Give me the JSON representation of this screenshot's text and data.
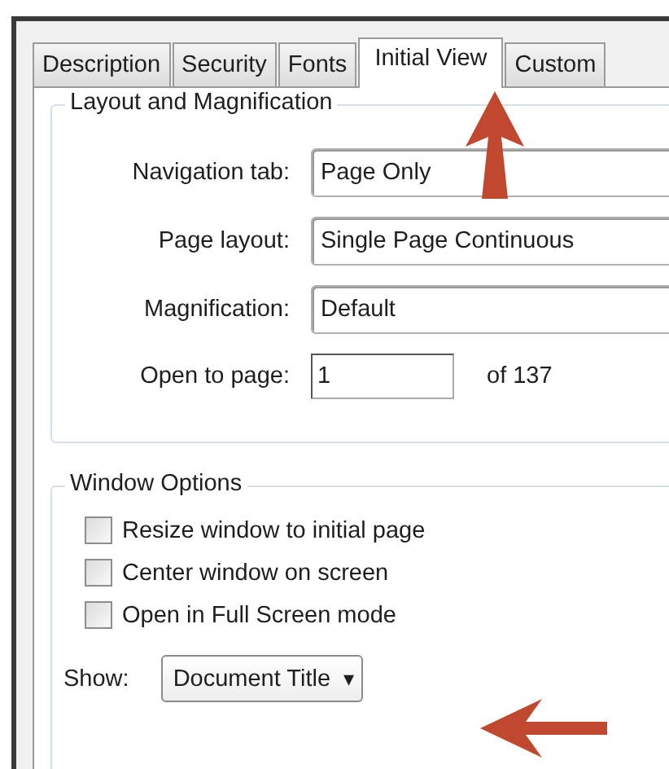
{
  "tabs": [
    {
      "label": "Description",
      "selected": false
    },
    {
      "label": "Security",
      "selected": false
    },
    {
      "label": "Fonts",
      "selected": false
    },
    {
      "label": "Initial View",
      "selected": true
    },
    {
      "label": "Custom",
      "selected": false
    }
  ],
  "layout_group": {
    "title": "Layout and Magnification",
    "fields": [
      {
        "label": "Navigation tab:",
        "value": "Page Only"
      },
      {
        "label": "Page layout:",
        "value": "Single Page Continuous"
      },
      {
        "label": "Magnification:",
        "value": "Default"
      }
    ],
    "open_to_page": {
      "label": "Open to page:",
      "value": "1",
      "suffix": "of 137"
    }
  },
  "window_group": {
    "title": "Window Options",
    "options": [
      {
        "label": "Resize window to initial page",
        "checked": false
      },
      {
        "label": "Center window on screen",
        "checked": false
      },
      {
        "label": "Open in Full Screen mode",
        "checked": false
      }
    ],
    "show": {
      "label": "Show:",
      "value": "Document Title",
      "arrow": "▾"
    }
  }
}
